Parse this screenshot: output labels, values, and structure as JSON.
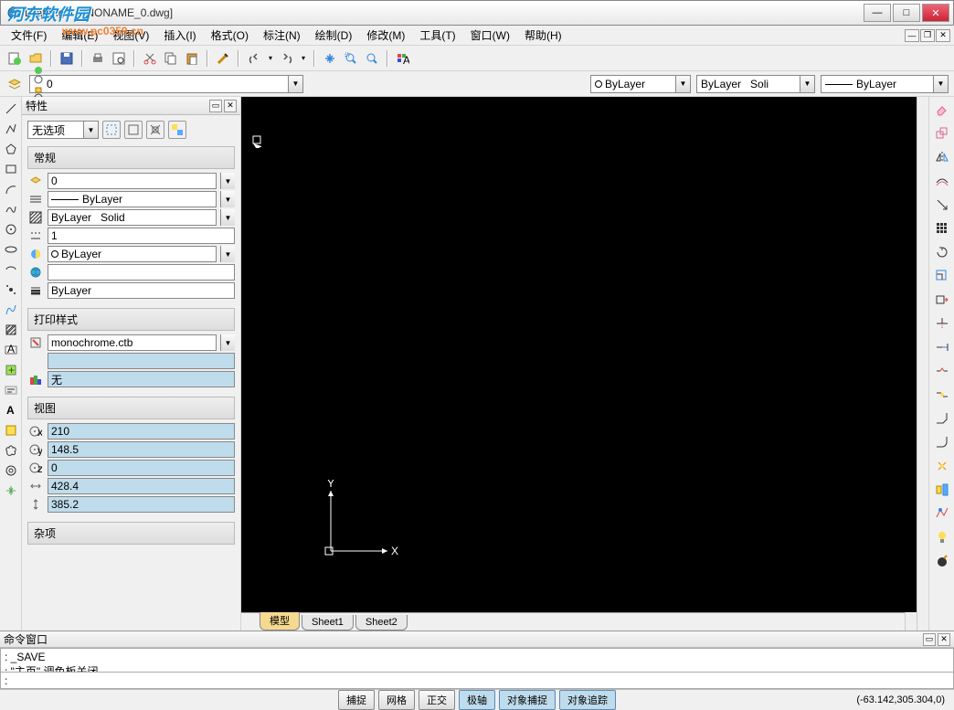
{
  "title": "DraftSight - [NONAME_0.dwg]",
  "menu": [
    "文件(F)",
    "编辑(E)",
    "视图(V)",
    "插入(I)",
    "格式(O)",
    "标注(N)",
    "绘制(D)",
    "修改(M)",
    "工具(T)",
    "窗口(W)",
    "帮助(H)"
  ],
  "layerbar": {
    "layer": "0",
    "color": "ByLayer",
    "ltype": "ByLayer",
    "ltype2": "Soli",
    "lw": "ByLayer"
  },
  "props": {
    "title": "特性",
    "noselect": "无选项",
    "g_general": "常规",
    "layer": "0",
    "ltype": "ByLayer",
    "ltype2": "ByLayer",
    "ltype2b": "Solid",
    "lscale": "1",
    "lcolor": "ByLayer",
    "lweight": "ByLayer",
    "g_print": "打印样式",
    "pstyle": "monochrome.ctb",
    "pnone": "无",
    "g_view": "视图",
    "vx": "210",
    "vy": "148.5",
    "vz": "0",
    "vw": "428.4",
    "vh": "385.2",
    "g_misc": "杂项"
  },
  "tabs": [
    "模型",
    "Sheet1",
    "Sheet2"
  ],
  "cmd": {
    "title": "命令窗口",
    "l1": ": _SAVE",
    "l2": ": \"主页\" 调色板关闭",
    "prompt": ": "
  },
  "status": [
    "捕捉",
    "网格",
    "正交",
    "极轴",
    "对象捕捉",
    "对象追踪"
  ],
  "coords": "(-63.142,305.304,0)",
  "axis": {
    "x": "X",
    "y": "Y"
  },
  "wm1": "河东软件园",
  "wm2": "www.pc0359.cn"
}
